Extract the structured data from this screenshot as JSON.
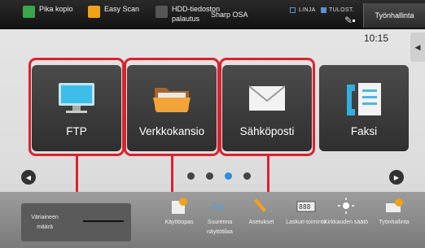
{
  "topbar": {
    "quick1": "Pika kopio",
    "quick2": "Easy Scan",
    "quick3": "HDD-tiedoston palautus",
    "quick4": "Sharp OSA",
    "status_line": "LINJA",
    "status_print": "TULOST.",
    "job_status": "Työnhallinta",
    "colors": {
      "quick1": "#3aa54a",
      "quick2": "#f2a21a",
      "quick4": "#d9232f"
    }
  },
  "clock": "10:15",
  "tiles": [
    {
      "label": "FTP",
      "icon": "monitor-icon"
    },
    {
      "label": "Verkkokansio",
      "icon": "folder-icon"
    },
    {
      "label": "Sähköposti",
      "icon": "envelope-icon"
    },
    {
      "label": "Faksi",
      "icon": "fax-phone-icon"
    }
  ],
  "pager": {
    "pages": 4,
    "current": 3
  },
  "bottom": {
    "color_mode_label": "Väriaineen määrä",
    "buttons": [
      {
        "label": "Käyttöopas",
        "icon": "manual-icon"
      },
      {
        "label": "Suurenna näyttötilaa",
        "icon": "zoom-display-icon"
      },
      {
        "label": "Asetukset",
        "icon": "settings-wrench-icon"
      },
      {
        "label": "Laskuri-toiminto",
        "icon": "counter-icon"
      },
      {
        "label": "Kirkkauden säätö",
        "icon": "brightness-icon"
      },
      {
        "label": "Työnhallinta",
        "icon": "job-status-icon"
      }
    ]
  },
  "accent": {
    "highlight": "#d9232f",
    "active_dot": "#2d8ee0"
  }
}
